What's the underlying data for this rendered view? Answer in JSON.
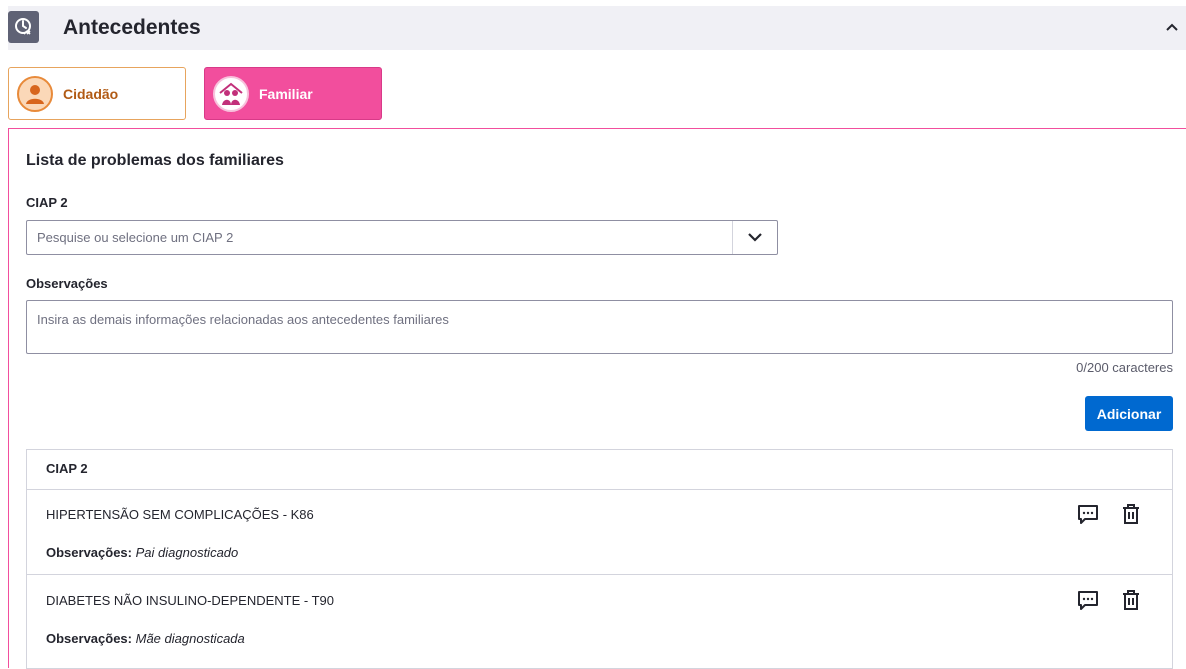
{
  "header": {
    "title": "Antecedentes",
    "icon": "history-clock-icon",
    "collapse_icon": "chevron-up-icon"
  },
  "tabs": [
    {
      "label": "Cidadão",
      "icon": "person-avatar-icon",
      "accent": "#e7a45d",
      "active": false
    },
    {
      "label": "Familiar",
      "icon": "family-avatar-icon",
      "accent": "#f24e9d",
      "active": true
    }
  ],
  "section": {
    "title": "Lista de problemas dos familiares"
  },
  "ciap_field": {
    "label": "CIAP 2",
    "placeholder": "Pesquise ou selecione um CIAP 2",
    "icon": "chevron-down-icon"
  },
  "observacoes_field": {
    "label": "Observações",
    "placeholder": "Insira as demais informações relacionadas aos antecedentes familiares",
    "counter": "0/200 caracteres"
  },
  "add_button": {
    "label": "Adicionar",
    "color": "#0069d0"
  },
  "table": {
    "header": "CIAP 2",
    "rows": [
      {
        "name": "HIPERTENSÃO SEM COMPLICAÇÕES - K86",
        "obs_label": "Observações:",
        "obs_value": "Pai diagnosticado"
      },
      {
        "name": "DIABETES NÃO INSULINO-DEPENDENTE - T90",
        "obs_label": "Observações:",
        "obs_value": "Mãe diagnosticada"
      }
    ],
    "row_icons": [
      "comment-icon",
      "trash-icon"
    ]
  }
}
